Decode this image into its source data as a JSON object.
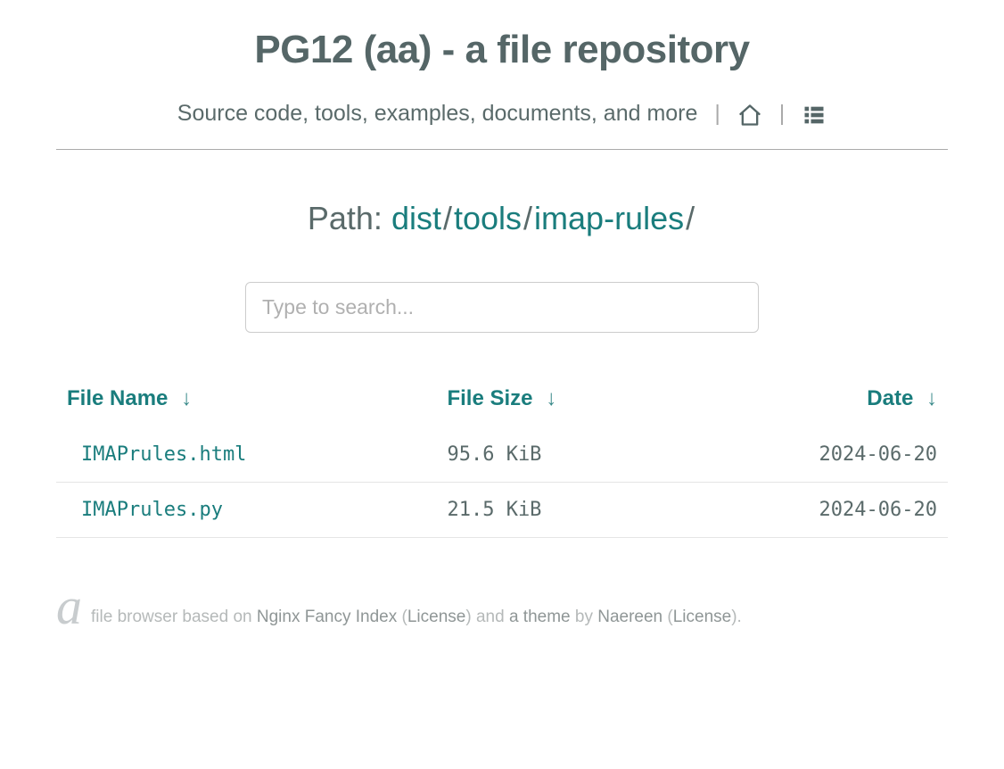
{
  "header": {
    "title": "PG12 (aa) - a file repository",
    "subtitle": "Source code, tools, examples, documents, and more"
  },
  "path": {
    "label": "Path: ",
    "segments": [
      "dist",
      "tools",
      "imap-rules"
    ]
  },
  "search": {
    "placeholder": "Type to search..."
  },
  "table": {
    "columns": {
      "name": "File Name",
      "size": "File Size",
      "date": "Date"
    },
    "rows": [
      {
        "name": "IMAPrules.html",
        "size": "95.6 KiB",
        "date": "2024-06-20"
      },
      {
        "name": "IMAPrules.py",
        "size": "21.5 KiB",
        "date": "2024-06-20"
      }
    ]
  },
  "footer": {
    "logo": "a",
    "pre": "file browser based on ",
    "link1": "Nginx Fancy Index",
    "lp1": " (",
    "license1": "License",
    "rp1": ") ",
    "and": "and ",
    "link2": "a theme",
    "by": " by ",
    "link3": "Naereen",
    "lp2": " (",
    "license2": "License",
    "rp2": ")."
  }
}
